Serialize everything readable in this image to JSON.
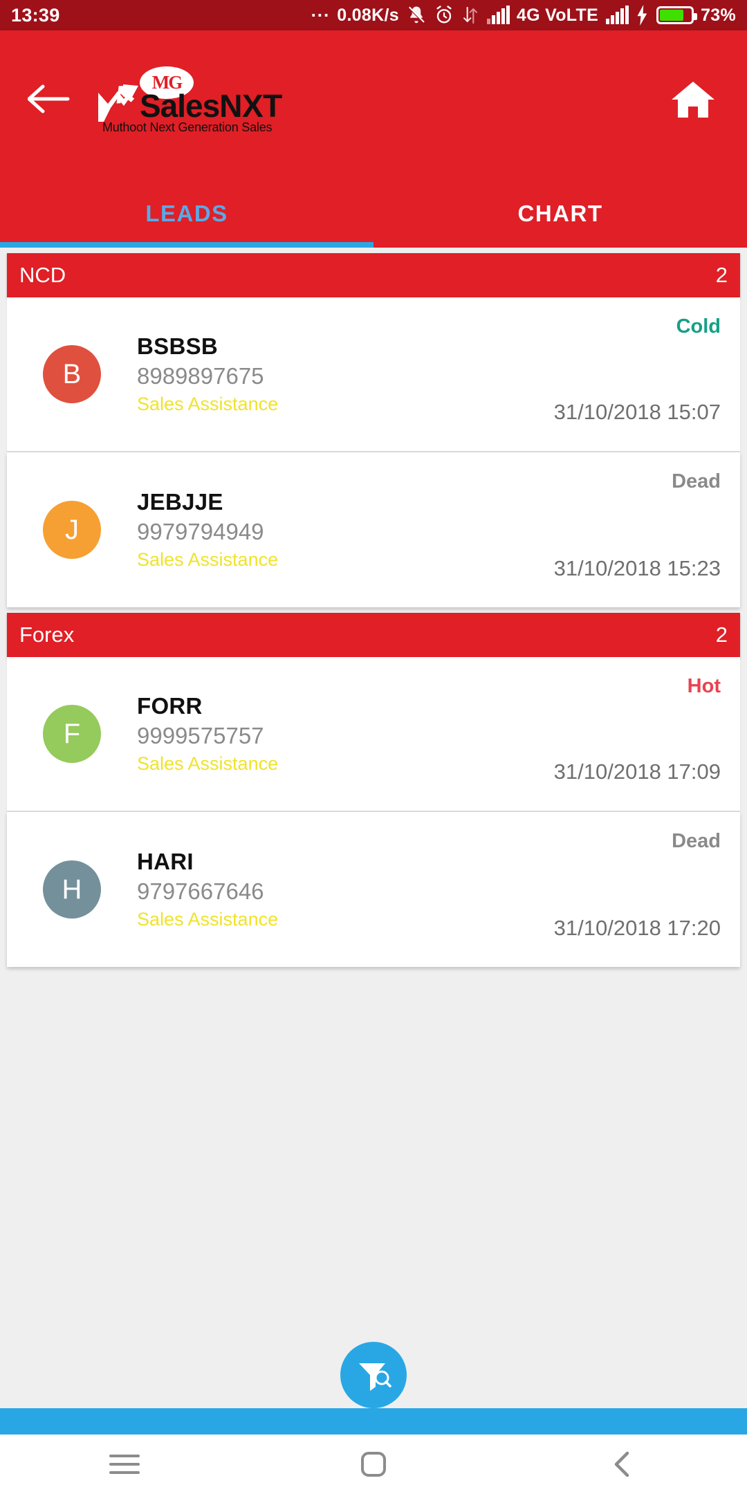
{
  "status_bar": {
    "clock": "13:39",
    "overflow": "...",
    "net_speed": "0.08K/s",
    "icons": [
      "bell-muted-icon",
      "alarm-icon",
      "data-transfer-icon",
      "signal-icon"
    ],
    "network_type": "4G VoLTE",
    "battery_percent": "73%",
    "battery_level": 73,
    "charging": true
  },
  "appbar": {
    "back_icon": "arrow-left-icon",
    "home_icon": "home-icon",
    "logo": {
      "badge_text": "MG",
      "name_light": "Sales",
      "name_bold": "NXT",
      "tagline": "Muthoot Next Generation Sales"
    },
    "bg_color": "#e01f26"
  },
  "tabs": {
    "items": [
      {
        "label": "LEADS",
        "active": true
      },
      {
        "label": "CHART",
        "active": false
      }
    ],
    "indicator_color": "#29a7e5",
    "active_color": "#5aa9e6"
  },
  "groups": [
    {
      "title": "NCD",
      "count": "2",
      "leads": [
        {
          "initial": "B",
          "avatar_color": "#e0503f",
          "name": "BSBSB",
          "phone": "8989897675",
          "type": "Sales Assistance",
          "status": "Cold",
          "status_kind": "cold",
          "status_color": "#16a085",
          "timestamp": "31/10/2018 15:07"
        },
        {
          "initial": "J",
          "avatar_color": "#f6a033",
          "name": "JEBJJE",
          "phone": "9979794949",
          "type": "Sales Assistance",
          "status": "Dead",
          "status_kind": "dead",
          "status_color": "#8a8a8a",
          "timestamp": "31/10/2018 15:23"
        }
      ]
    },
    {
      "title": "Forex",
      "count": "2",
      "leads": [
        {
          "initial": "F",
          "avatar_color": "#95ca5c",
          "name": "FORR",
          "phone": "9999575757",
          "type": "Sales Assistance",
          "status": "Hot",
          "status_kind": "hot",
          "status_color": "#e8434f",
          "timestamp": "31/10/2018 17:09"
        },
        {
          "initial": "H",
          "avatar_color": "#74909b",
          "name": "HARI",
          "phone": "9797667646",
          "type": "Sales Assistance",
          "status": "Dead",
          "status_kind": "dead",
          "status_color": "#8a8a8a",
          "timestamp": "31/10/2018 17:20"
        }
      ]
    }
  ],
  "fab": {
    "icon": "filter-search-icon",
    "color": "#29a7e5"
  },
  "navbar": {
    "buttons": [
      {
        "icon": "menu-icon"
      },
      {
        "icon": "home-square-icon"
      },
      {
        "icon": "back-chevron-icon"
      }
    ]
  }
}
